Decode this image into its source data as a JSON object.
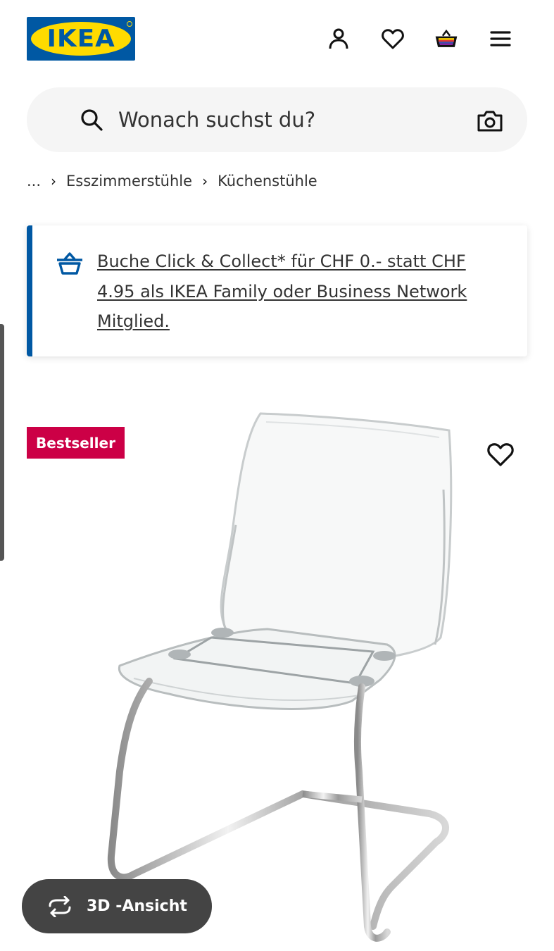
{
  "header": {
    "logo_text": "IKEA",
    "icons": [
      "profile-icon",
      "heart-icon",
      "basket-icon",
      "menu-icon"
    ]
  },
  "search": {
    "placeholder": "Wonach suchst du?",
    "icons": [
      "search-icon",
      "camera-icon"
    ]
  },
  "breadcrumb": {
    "ellipsis": "...",
    "items": [
      "Esszimmerstühle",
      "Küchenstühle"
    ]
  },
  "notice": {
    "text": "Buche Click & Collect* für CHF 0.- statt CHF 4.95 als IKEA Family oder Business Network Mitglied.",
    "icon": "basket-icon"
  },
  "product": {
    "badge": "Bestseller",
    "favorite_icon": "heart-icon",
    "image": "transparent-chair-image"
  },
  "view3d": {
    "label": "3D -Ansicht",
    "icon": "rotate-icon"
  },
  "colors": {
    "ikea_blue": "#0058a3",
    "ikea_yellow": "#ffdb00",
    "bestseller_red": "#cc0046",
    "pill_gray": "#444444"
  }
}
